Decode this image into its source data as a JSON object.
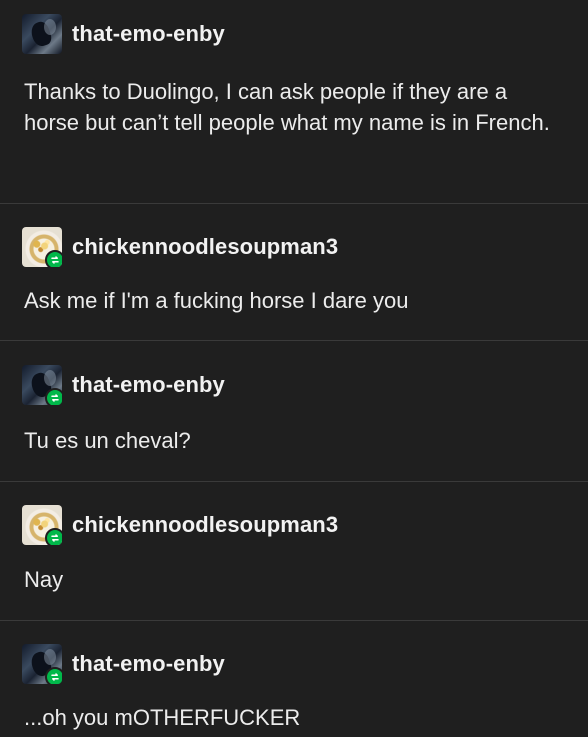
{
  "thread": {
    "posts": [
      {
        "username": "that-emo-enby",
        "text": "Thanks to Duolingo, I can ask people if they are a horse but can’t tell people what my name is in French."
      },
      {
        "username": "chickennoodlesoupman3",
        "text": "Ask me if I'm a fucking horse I dare you"
      },
      {
        "username": "that-emo-enby",
        "text": "Tu es un cheval?"
      },
      {
        "username": "chickennoodlesoupman3",
        "text": "Nay"
      },
      {
        "username": "that-emo-enby",
        "text": "...oh you mOTHERFUCKER"
      }
    ]
  },
  "colors": {
    "background": "#1f1f1f",
    "text": "#ececec",
    "divider": "#3a3a3a",
    "reblog_badge": "#00b84a"
  },
  "icons": {
    "post_1_avatar": "emo-avatar-icon",
    "post_2_avatar": "soup-avatar-icon",
    "post_3_avatar": "emo-avatar-icon",
    "post_4_avatar": "soup-avatar-icon",
    "post_5_avatar": "emo-avatar-icon",
    "reblog_badge": "reblog-icon"
  }
}
